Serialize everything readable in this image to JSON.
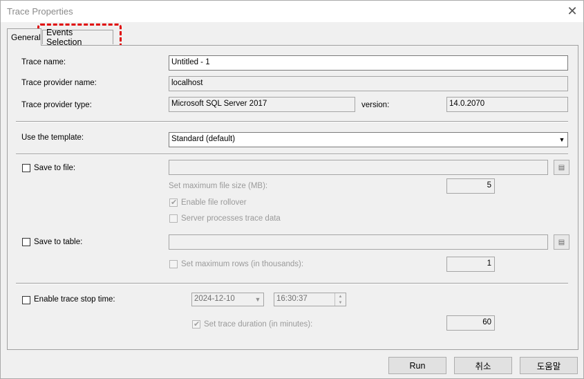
{
  "window": {
    "title": "Trace Properties",
    "close_glyph": "✕"
  },
  "tabs": {
    "general": "General",
    "events": "Events Selection"
  },
  "general": {
    "trace_name_label": "Trace name:",
    "trace_name_value": "Untitled - 1",
    "provider_name_label": "Trace provider name:",
    "provider_name_value": "localhost",
    "provider_type_label": "Trace provider type:",
    "provider_type_value": "Microsoft SQL Server 2017",
    "version_label": "version:",
    "version_value": "14.0.2070",
    "template_label": "Use the template:",
    "template_value": "Standard (default)",
    "save_file_label": "Save to file:",
    "max_file_size_label": "Set maximum file size (MB):",
    "max_file_size_value": "5",
    "rollover_label": "Enable file rollover",
    "server_processes_label": "Server processes trace data",
    "save_table_label": "Save to table:",
    "max_rows_label": "Set maximum rows (in thousands):",
    "max_rows_value": "1",
    "stop_time_label": "Enable trace stop time:",
    "stop_date_value": "2024-12-10",
    "stop_time_value": "16:30:37",
    "duration_label": "Set trace duration (in minutes):",
    "duration_value": "60"
  },
  "buttons": {
    "run": "Run",
    "cancel": "취소",
    "help": "도움말"
  }
}
